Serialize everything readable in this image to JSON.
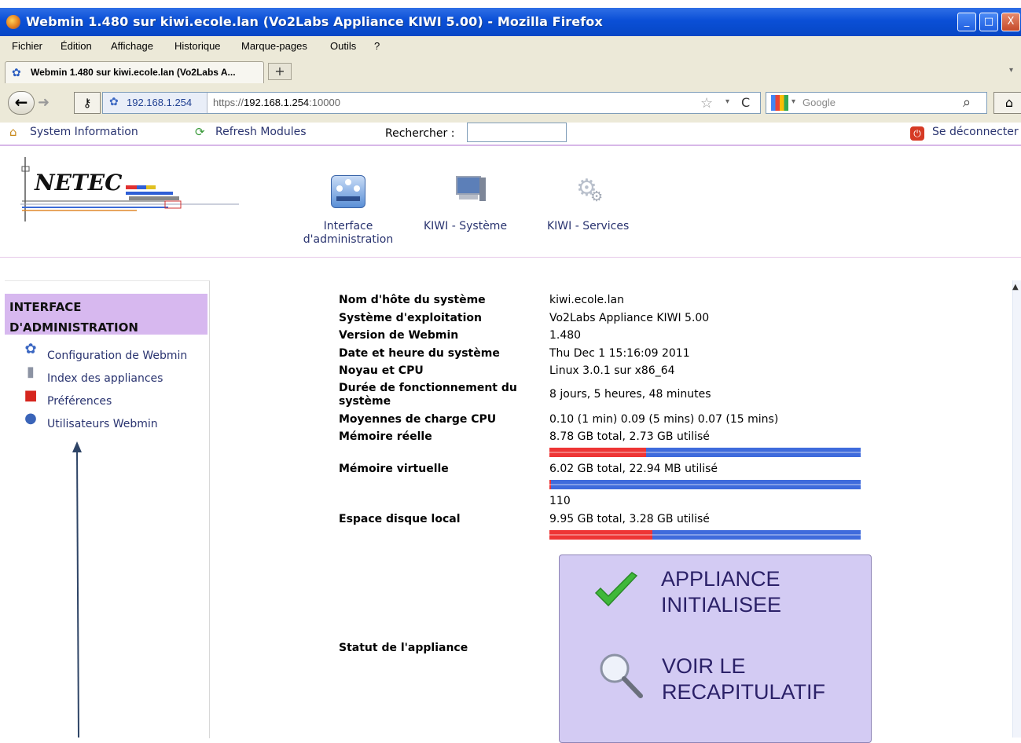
{
  "window": {
    "title": "Webmin 1.480 sur kiwi.ecole.lan (Vo2Labs Appliance KIWI 5.00) - Mozilla Firefox",
    "buttons": [
      "_",
      "□",
      "X"
    ]
  },
  "menu": [
    "Fichier",
    "Édition",
    "Affichage",
    "Historique",
    "Marque-pages",
    "Outils",
    "?"
  ],
  "tab": {
    "label": "Webmin 1.480 sur kiwi.ecole.lan (Vo2Labs A...",
    "new_tab": "+"
  },
  "nav": {
    "site": "192.168.1.254",
    "url_scheme": "https://",
    "url_host": "192.168.1.254",
    "url_port": ":10000",
    "search_placeholder": "Google"
  },
  "webmin_bar": {
    "system_info": "System Information",
    "refresh": "Refresh Modules",
    "search_label": "Rechercher :",
    "logout": "Se déconnecter"
  },
  "logo": "NETEC",
  "modules": [
    {
      "label1": "Interface",
      "label2": "d'administration"
    },
    {
      "label1": "KIWI - Système"
    },
    {
      "label1": "KIWI - Services"
    }
  ],
  "sidebar": {
    "heading1": "INTERFACE",
    "heading2": "D'ADMINISTRATION",
    "items": [
      "Configuration de Webmin",
      "Index des appliances",
      "Préférences",
      "Utilisateurs Webmin"
    ]
  },
  "info": {
    "hostname_label": "Nom d'hôte du système",
    "hostname": "kiwi.ecole.lan",
    "os_label": "Système d'exploitation",
    "os": "Vo2Labs Appliance KIWI 5.00",
    "version_label": "Version de Webmin",
    "version": "1.480",
    "date_label": "Date et heure du système",
    "date": "Thu Dec 1 15:16:09 2011",
    "kernel_label": "Noyau et CPU",
    "kernel": "Linux 3.0.1 sur x86_64",
    "uptime_label1": "Durée de fonctionnement du",
    "uptime_label2": "système",
    "uptime": "8 jours, 5 heures, 48 minutes",
    "load_label": "Moyennes de charge CPU",
    "load": "0.10 (1 min) 0.09 (5 mins) 0.07 (15 mins)",
    "ram_label": "Mémoire réelle",
    "ram": "8.78 GB total, 2.73 GB utilisé",
    "ram_used_fraction": 0.31,
    "swap_label": "Mémoire virtuelle",
    "swap": "6.02 GB total, 22.94 MB utilisé",
    "swap_used_fraction": 0.004,
    "extra": "110",
    "disk_label": "Espace disque local",
    "disk": "9.95 GB total, 3.28 GB utilisé",
    "disk_used_fraction": 0.33,
    "status_label": "Statut de l'appliance"
  },
  "appliance": {
    "line1": "APPLIANCE",
    "line2": "INITIALISEE",
    "line3": "VOIR LE",
    "line4": "RECAPITULATIF"
  }
}
